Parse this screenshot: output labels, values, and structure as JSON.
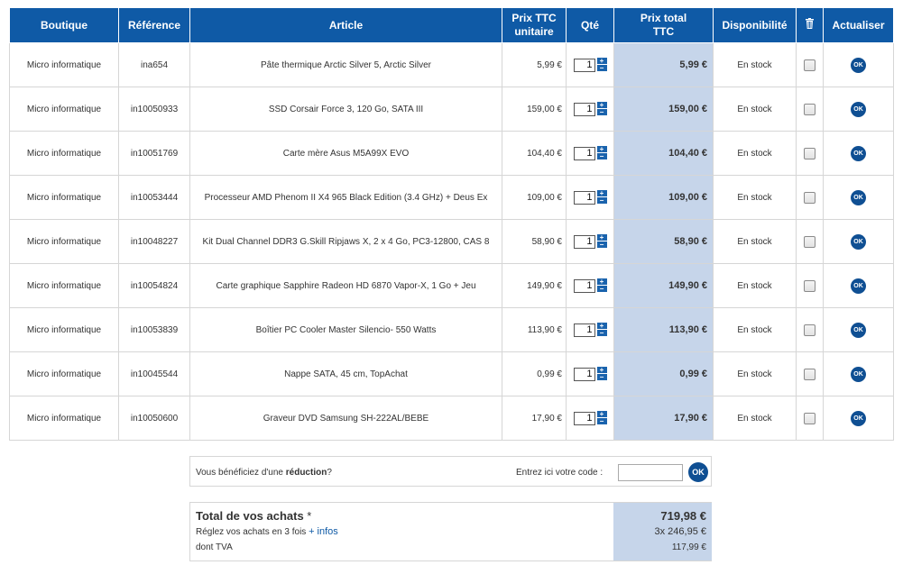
{
  "colors": {
    "header_bg": "#0f5aa6",
    "total_bg": "#c6d5ea",
    "ok_btn": "#0f4f93"
  },
  "table": {
    "headers": {
      "shop": "Boutique",
      "ref": "Référence",
      "article": "Article",
      "unit_price_l1": "Prix TTC",
      "unit_price_l2": "unitaire",
      "qty": "Qté",
      "total_l1": "Prix total",
      "total_l2": "TTC",
      "availability": "Disponibilité",
      "delete_icon": "trash-icon",
      "update": "Actualiser"
    },
    "rows": [
      {
        "shop": "Micro informatique",
        "ref": "ina654",
        "article": "Pâte thermique Arctic Silver 5, Arctic Silver",
        "unit": "5,99 €",
        "qty": "1",
        "total": "5,99 €",
        "avail": "En stock",
        "ok": "OK"
      },
      {
        "shop": "Micro informatique",
        "ref": "in10050933",
        "article": "SSD Corsair Force 3, 120 Go, SATA III",
        "unit": "159,00 €",
        "qty": "1",
        "total": "159,00 €",
        "avail": "En stock",
        "ok": "OK"
      },
      {
        "shop": "Micro informatique",
        "ref": "in10051769",
        "article": "Carte mère Asus M5A99X EVO",
        "unit": "104,40 €",
        "qty": "1",
        "total": "104,40 €",
        "avail": "En stock",
        "ok": "OK"
      },
      {
        "shop": "Micro informatique",
        "ref": "in10053444",
        "article": "Processeur AMD Phenom II X4 965 Black Edition (3.4 GHz) + Deus Ex",
        "unit": "109,00 €",
        "qty": "1",
        "total": "109,00 €",
        "avail": "En stock",
        "ok": "OK"
      },
      {
        "shop": "Micro informatique",
        "ref": "in10048227",
        "article": "Kit Dual Channel DDR3 G.Skill Ripjaws X, 2 x 4 Go, PC3-12800, CAS 8",
        "unit": "58,90 €",
        "qty": "1",
        "total": "58,90 €",
        "avail": "En stock",
        "ok": "OK"
      },
      {
        "shop": "Micro informatique",
        "ref": "in10054824",
        "article": "Carte graphique Sapphire Radeon HD 6870 Vapor-X, 1 Go + Jeu",
        "unit": "149,90 €",
        "qty": "1",
        "total": "149,90 €",
        "avail": "En stock",
        "ok": "OK"
      },
      {
        "shop": "Micro informatique",
        "ref": "in10053839",
        "article": "Boîtier PC Cooler Master Silencio- 550 Watts",
        "unit": "113,90 €",
        "qty": "1",
        "total": "113,90 €",
        "avail": "En stock",
        "ok": "OK"
      },
      {
        "shop": "Micro informatique",
        "ref": "in10045544",
        "article": "Nappe SATA, 45 cm, TopAchat",
        "unit": "0,99 €",
        "qty": "1",
        "total": "0,99 €",
        "avail": "En stock",
        "ok": "OK"
      },
      {
        "shop": "Micro informatique",
        "ref": "in10050600",
        "article": "Graveur DVD Samsung SH-222AL/BEBE",
        "unit": "17,90 €",
        "qty": "1",
        "total": "17,90 €",
        "avail": "En stock",
        "ok": "OK"
      }
    ]
  },
  "promo": {
    "text_prefix": "Vous bénéficiez d'une ",
    "text_bold": "réduction",
    "text_suffix": "?",
    "code_label": "Entrez ici votre code :",
    "code_value": "",
    "ok": "OK"
  },
  "summary": {
    "total_label": "Total de vos achats",
    "total_star": " *",
    "total_value": "719,98 €",
    "installments_label": "Réglez vos achats en 3 fois ",
    "infos_link": "+ infos",
    "installments_value": "3x  246,95 €",
    "vat_label": "dont TVA",
    "vat_value": "117,99 €"
  }
}
